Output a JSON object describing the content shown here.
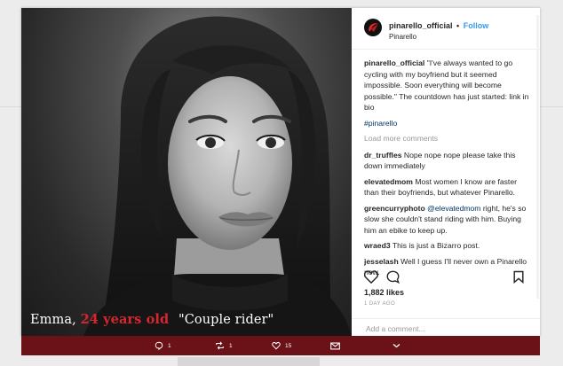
{
  "post": {
    "caption_overlay": {
      "name": "Emma,",
      "age": "24 years old",
      "quote": "\"Couple rider\""
    }
  },
  "account": {
    "username": "pinarello_official",
    "separator": "•",
    "follow_label": "Follow",
    "subtitle": "Pinarello"
  },
  "caption": {
    "user": "pinarello_official",
    "text": "\"I've always wanted to go cycling with my boyfriend but it seemed impossible. Soon everything will become possible.\" The countdown has just started: link in bio",
    "hashtag": "#pinarello"
  },
  "load_more": "Load more comments",
  "comments": [
    {
      "user": "dr_truffles",
      "text": "Nope nope nope please take this down immediately"
    },
    {
      "user": "elevatedmom",
      "text": "Most women I know are faster than their boyfriends, but whatever Pinarello."
    },
    {
      "user": "greencurryphoto",
      "mention": "@elevatedmom",
      "text": "right, he's so slow she couldn't stand riding with him. Buying him an ebike to keep up."
    },
    {
      "user": "wraed3",
      "text": "This is just a Bizarro post."
    },
    {
      "user": "jesselash",
      "text": "Well I guess I'll never own a Pinarello now."
    }
  ],
  "likes": "1,882 likes",
  "time": "1 DAY AGO",
  "add_comment_placeholder": "Add a comment...",
  "toolbar": {
    "comments_count": "1",
    "reposts_count": "1",
    "likes_count": "15",
    "icons": [
      "comment-icon",
      "repost-icon",
      "heart-icon",
      "mail-icon",
      "chevron-down-icon"
    ]
  },
  "colors": {
    "toolbar_bg": "#6b1118",
    "caption_accent": "#d7262e",
    "follow": "#3897f0"
  }
}
